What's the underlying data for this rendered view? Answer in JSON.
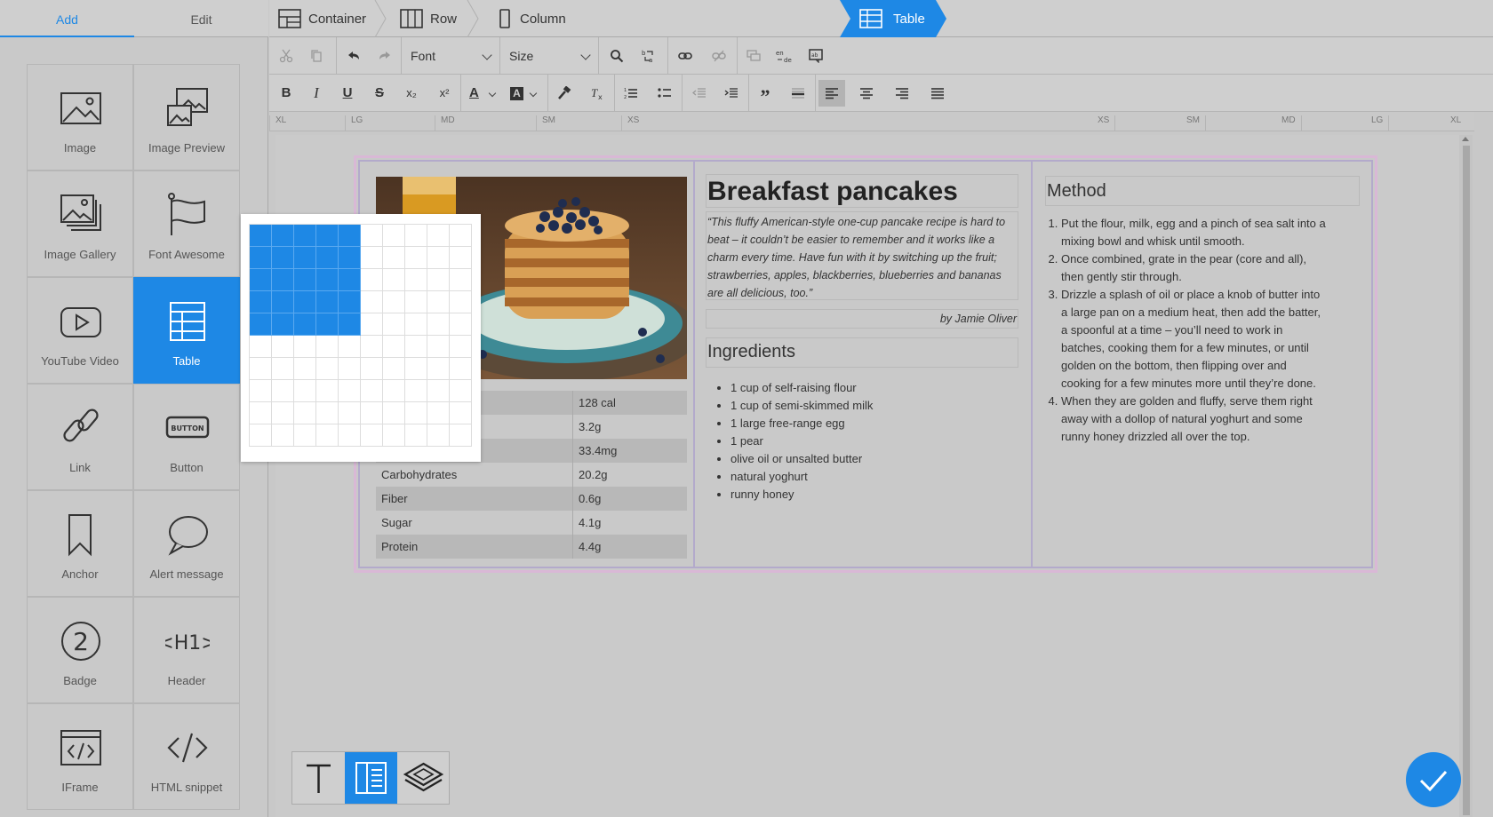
{
  "left_panel": {
    "tabs": [
      {
        "label": "Add",
        "active": true
      },
      {
        "label": "Edit",
        "active": false
      }
    ],
    "blocks": [
      {
        "label": "Image",
        "icon": "image-icon"
      },
      {
        "label": "Image Preview",
        "icon": "image-preview-icon"
      },
      {
        "label": "Image Gallery",
        "icon": "image-gallery-icon"
      },
      {
        "label": "Font Awesome",
        "icon": "flag-icon"
      },
      {
        "label": "YouTube Video",
        "icon": "play-icon"
      },
      {
        "label": "Table",
        "icon": "table-icon",
        "active": true
      },
      {
        "label": "Link",
        "icon": "link-icon"
      },
      {
        "label": "Button",
        "icon": "button-icon",
        "icon_text": "BUTTON"
      },
      {
        "label": "Anchor",
        "icon": "bookmark-icon"
      },
      {
        "label": "Alert message",
        "icon": "speech-bubble-icon"
      },
      {
        "label": "Badge",
        "icon": "badge-icon",
        "icon_text": "2"
      },
      {
        "label": "Header",
        "icon": "header-icon",
        "icon_text": "<H1>"
      },
      {
        "label": "IFrame",
        "icon": "iframe-icon"
      },
      {
        "label": "HTML snippet",
        "icon": "code-icon"
      }
    ]
  },
  "table_picker": {
    "rows": 10,
    "cols": 10,
    "selected_rows": 5,
    "selected_cols": 5
  },
  "breadcrumb": [
    {
      "label": "Container",
      "icon": "container-icon"
    },
    {
      "label": "Row",
      "icon": "row-icon"
    },
    {
      "label": "Column",
      "icon": "column-icon"
    },
    {
      "label": "Table",
      "icon": "table-icon",
      "active": true
    }
  ],
  "toolbar": {
    "font_label": "Font",
    "size_label": "Size",
    "row1_icons": [
      "cut-icon",
      "copy-icon",
      "undo-icon",
      "redo-icon",
      "search-icon",
      "replace-icon",
      "link-icon",
      "unlink-icon",
      "comment-icon",
      "translate-icon",
      "spellcheck-icon"
    ],
    "row2_icons": [
      "bold-icon",
      "italic-icon",
      "underline-icon",
      "strikethrough-icon",
      "subscript-icon",
      "superscript-icon",
      "text-color-icon",
      "background-color-icon",
      "format-painter-icon",
      "clear-format-icon",
      "numbered-list-icon",
      "bulleted-list-icon",
      "outdent-icon",
      "indent-icon",
      "blockquote-icon",
      "horizontal-rule-icon",
      "align-left-icon",
      "align-center-icon",
      "align-right-icon",
      "justify-icon"
    ],
    "bold": "B",
    "italic": "I",
    "underline": "U",
    "strike": "S",
    "sub": "x₂",
    "sup": "x²",
    "quote": "99",
    "color_a": "A",
    "bg_a": "A"
  },
  "ruler": [
    "XL",
    "LG",
    "MD",
    "SM",
    "XS",
    "XS",
    "SM",
    "MD",
    "LG",
    "XL"
  ],
  "recipe": {
    "title": "Breakfast pancakes",
    "quote": "“This fluffy American-style one-cup pancake recipe is hard to beat – it couldn’t be easier to remember and it works like a charm every time. Have fun with it by switching up the fruit; strawberries, apples, blackberries, blueberries and bananas are all delicious, too.”",
    "author": "by Jamie Oliver",
    "ingredients_heading": "Ingredients",
    "ingredients": [
      "1 cup of self-raising flour",
      "1 cup of semi-skimmed milk",
      "1 large free-range egg",
      "1 pear",
      "olive oil or unsalted butter",
      "natural yoghurt",
      "runny honey"
    ],
    "method_heading": "Method",
    "method": [
      "Put the flour, milk, egg and a pinch of sea salt into a mixing bowl and whisk until smooth.",
      "Once combined, grate in the pear (core and all), then gently stir through.",
      "Drizzle a splash of oil or place a knob of butter into a large pan on a medium heat, then add the batter, a spoonful at a time – you’ll need to work in batches, cooking them for a few minutes, or until golden on the bottom, then flipping over and cooking for a few minutes more until they’re done.",
      "When they are golden and fluffy, serve them right away with a dollop of natural yoghurt and some runny honey drizzled all over the top."
    ],
    "nutrition": [
      {
        "name": "",
        "value": "128 cal"
      },
      {
        "name": "",
        "value": "3.2g"
      },
      {
        "name": "",
        "value": "33.4mg"
      },
      {
        "name": "Carbohydrates",
        "value": "20.2g"
      },
      {
        "name": "Fiber",
        "value": "0.6g"
      },
      {
        "name": "Sugar",
        "value": "4.1g"
      },
      {
        "name": "Protein",
        "value": "4.4g"
      }
    ]
  },
  "modes": [
    {
      "icon": "text-mode-icon"
    },
    {
      "icon": "layout-mode-icon",
      "active": true
    },
    {
      "icon": "layers-mode-icon"
    }
  ],
  "colors": {
    "accent": "#1e88e5",
    "panel": "#c9c9c9",
    "row_border": "#d9b8d6"
  }
}
